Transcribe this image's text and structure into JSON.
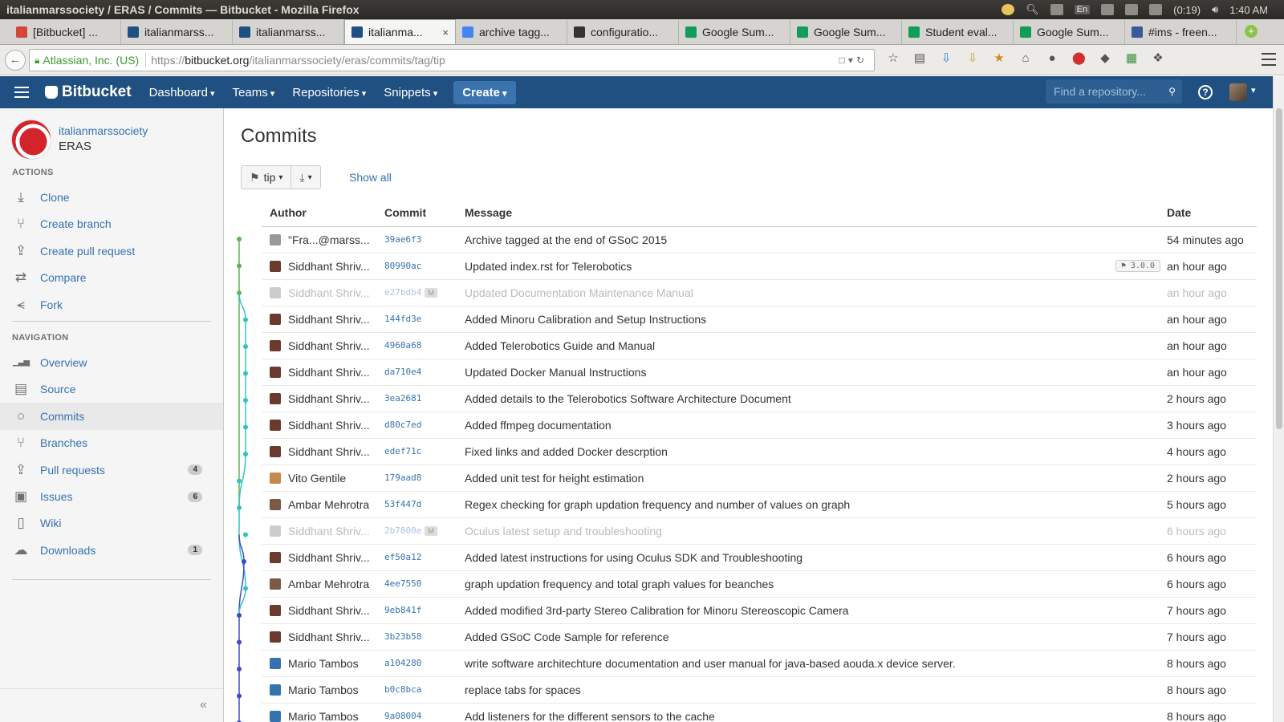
{
  "os": {
    "title": "italianmarssociety / ERAS / Commits — Bitbucket - Mozilla Firefox",
    "tray": {
      "lang": "En",
      "battery": "(0:19)",
      "time": "1:40 AM"
    }
  },
  "browser": {
    "tabs": [
      {
        "label": "[Bitbucket] ...",
        "color": "#d44638"
      },
      {
        "label": "italianmarss...",
        "color": "#205081"
      },
      {
        "label": "italianmarss...",
        "color": "#205081"
      },
      {
        "label": "italianma...",
        "color": "#205081"
      },
      {
        "label": "archive tagg...",
        "color": "#4285f4"
      },
      {
        "label": "configuratio...",
        "color": "#333333"
      },
      {
        "label": "Google Sum...",
        "color": "#0f9d58"
      },
      {
        "label": "Google Sum...",
        "color": "#0f9d58"
      },
      {
        "label": "Student eval...",
        "color": "#0f9d58"
      },
      {
        "label": "Google Sum...",
        "color": "#0f9d58"
      },
      {
        "label": "#ims - freen...",
        "color": "#3b5998"
      }
    ],
    "active_tab": 3,
    "close_glyph": "×",
    "new_tab_glyph": "+",
    "url": {
      "org": "Atlassian, Inc. (US)",
      "scheme": "https://",
      "host": "bitbucket.org",
      "path": "/italianmarssociety/eras/commits/tag/tip"
    }
  },
  "header": {
    "logo": "Bitbucket",
    "nav": [
      "Dashboard",
      "Teams",
      "Repositories",
      "Snippets"
    ],
    "create": "Create",
    "search_placeholder": "Find a repository...",
    "help": "?"
  },
  "sidebar": {
    "owner": "italianmarssociety",
    "repo": "ERAS",
    "actions_heading": "ACTIONS",
    "actions": [
      {
        "label": "Clone",
        "icon": "download-icon"
      },
      {
        "label": "Create branch",
        "icon": "branch-icon"
      },
      {
        "label": "Create pull request",
        "icon": "pull-request-icon"
      },
      {
        "label": "Compare",
        "icon": "compare-icon"
      },
      {
        "label": "Fork",
        "icon": "fork-icon"
      }
    ],
    "navigation_heading": "NAVIGATION",
    "navigation": [
      {
        "label": "Overview",
        "icon": "chart-icon"
      },
      {
        "label": "Source",
        "icon": "file-icon"
      },
      {
        "label": "Commits",
        "icon": "commit-icon",
        "active": true
      },
      {
        "label": "Branches",
        "icon": "branch-icon"
      },
      {
        "label": "Pull requests",
        "icon": "pull-request-icon",
        "count": "4"
      },
      {
        "label": "Issues",
        "icon": "issue-icon",
        "count": "6"
      },
      {
        "label": "Wiki",
        "icon": "page-icon"
      },
      {
        "label": "Downloads",
        "icon": "cloud-icon",
        "count": "1"
      }
    ],
    "collapse": "«"
  },
  "main": {
    "title": "Commits",
    "tag_button": "tip",
    "show_all": "Show all",
    "columns": [
      "Author",
      "Commit",
      "Message",
      "Date"
    ],
    "commits": [
      {
        "author": "\"Fra...@marss...",
        "hash": "39ae6f3",
        "message": "Archive tagged at the end of GSoC 2015",
        "date": "54 minutes ago",
        "avatar": "#999999"
      },
      {
        "author": "Siddhant Shriv...",
        "hash": "80990ac",
        "message": "Updated index.rst for Telerobotics",
        "date": "an hour ago",
        "tag": "3.0.0",
        "avatar": "#6b3a2e"
      },
      {
        "author": "Siddhant Shriv...",
        "hash": "e27bdb4",
        "message": "Updated Documentation Maintenance Manual",
        "date": "an hour ago",
        "merge": "M",
        "avatar": "#cccccc"
      },
      {
        "author": "Siddhant Shriv...",
        "hash": "144fd3e",
        "message": "Added Minoru Calibration and Setup Instructions",
        "date": "an hour ago",
        "avatar": "#6b3a2e"
      },
      {
        "author": "Siddhant Shriv...",
        "hash": "4960a68",
        "message": "Added Telerobotics Guide and Manual",
        "date": "an hour ago",
        "avatar": "#6b3a2e"
      },
      {
        "author": "Siddhant Shriv...",
        "hash": "da710e4",
        "message": "Updated Docker Manual Instructions",
        "date": "an hour ago",
        "avatar": "#6b3a2e"
      },
      {
        "author": "Siddhant Shriv...",
        "hash": "3ea2681",
        "message": "Added details to the Telerobotics Software Architecture Document",
        "date": "2 hours ago",
        "avatar": "#6b3a2e"
      },
      {
        "author": "Siddhant Shriv...",
        "hash": "d80c7ed",
        "message": "Added ffmpeg documentation",
        "date": "3 hours ago",
        "avatar": "#6b3a2e"
      },
      {
        "author": "Siddhant Shriv...",
        "hash": "edef71c",
        "message": "Fixed links and added Docker descrption",
        "date": "4 hours ago",
        "avatar": "#6b3a2e"
      },
      {
        "author": "Vito Gentile",
        "hash": "179aad8",
        "message": "Added unit test for height estimation",
        "date": "2 hours ago",
        "avatar": "#c58a4a"
      },
      {
        "author": "Ambar Mehrotra",
        "hash": "53f447d",
        "message": "Regex checking for graph updation frequency and number of values on graph",
        "date": "5 hours ago",
        "avatar": "#7a5a44"
      },
      {
        "author": "Siddhant Shriv...",
        "hash": "2b7800e",
        "message": "Oculus latest setup and troubleshooting",
        "date": "6 hours ago",
        "merge": "M",
        "avatar": "#cccccc"
      },
      {
        "author": "Siddhant Shriv...",
        "hash": "ef50a12",
        "message": "Added latest instructions for using Oculus SDK and Troubleshooting",
        "date": "6 hours ago",
        "avatar": "#6b3a2e"
      },
      {
        "author": "Ambar Mehrotra",
        "hash": "4ee7550",
        "message": "graph updation frequency and total graph values for beanches",
        "date": "6 hours ago",
        "avatar": "#7a5a44"
      },
      {
        "author": "Siddhant Shriv...",
        "hash": "9eb841f",
        "message": "Added modified 3rd-party Stereo Calibration for Minoru Stereoscopic Camera",
        "date": "7 hours ago",
        "avatar": "#6b3a2e"
      },
      {
        "author": "Siddhant Shriv...",
        "hash": "3b23b58",
        "message": "Added GSoC Code Sample for reference",
        "date": "7 hours ago",
        "avatar": "#6b3a2e"
      },
      {
        "author": "Mario Tambos",
        "hash": "a104280",
        "message": "write software architechture documentation and user manual for java-based aouda.x device server.",
        "date": "8 hours ago",
        "avatar": "#3572b0"
      },
      {
        "author": "Mario Tambos",
        "hash": "b0c8bca",
        "message": "replace tabs for spaces",
        "date": "8 hours ago",
        "avatar": "#3572b0"
      },
      {
        "author": "Mario Tambos",
        "hash": "9a08004",
        "message": "Add listeners for the different sensors to the cache",
        "date": "8 hours ago",
        "avatar": "#3572b0"
      }
    ],
    "graph_colors": [
      "#59b94b",
      "#2ec5c1",
      "#3d4bc8"
    ]
  }
}
